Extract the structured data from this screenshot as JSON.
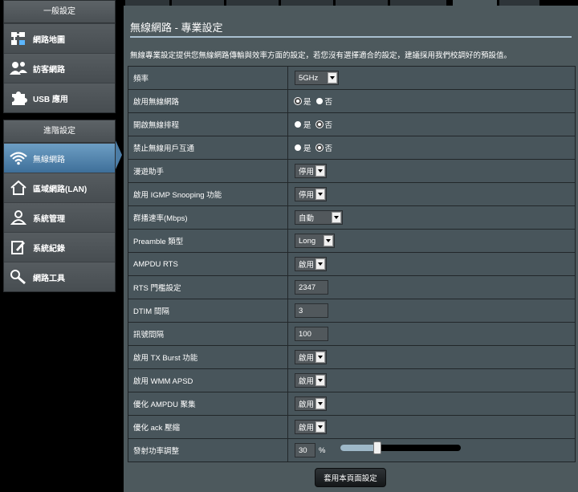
{
  "sidebar": {
    "general_title": "一般設定",
    "general_items": [
      {
        "label": "網路地圖",
        "icon": "network-map-icon"
      },
      {
        "label": "訪客網路",
        "icon": "guest-network-icon"
      },
      {
        "label": "USB 應用",
        "icon": "usb-app-icon"
      }
    ],
    "advanced_title": "進階設定",
    "advanced_items": [
      {
        "label": "無線網路",
        "icon": "wifi-icon",
        "active": true
      },
      {
        "label": "區域網路(LAN)",
        "icon": "home-icon"
      },
      {
        "label": "系統管理",
        "icon": "admin-user-icon"
      },
      {
        "label": "系統紀錄",
        "icon": "log-edit-icon"
      },
      {
        "label": "網路工具",
        "icon": "tools-icon"
      }
    ]
  },
  "page": {
    "title": "無線網路 - 專業設定",
    "description": "無線專業設定提供您無線網路傳輸與效率方面的設定，若您沒有選擇適合的設定，建議採用我們校調好的預設值。",
    "apply_label": "套用本頁面設定"
  },
  "settings": {
    "band": {
      "label": "頻率",
      "value": "5GHz"
    },
    "enable_radio": {
      "label": "啟用無線網路",
      "yes": "是",
      "no": "否"
    },
    "enable_schedule": {
      "label": "開啟無線排程",
      "yes": "是",
      "no": "否"
    },
    "isolation": {
      "label": "禁止無線用戶互通",
      "yes": "是",
      "no": "否"
    },
    "roaming": {
      "label": "漫遊助手",
      "value": "停用"
    },
    "igmp": {
      "label": "啟用 IGMP Snooping 功能",
      "value": "停用"
    },
    "multicast": {
      "label": "群播速率(Mbps)",
      "value": "自動"
    },
    "preamble": {
      "label": "Preamble 類型",
      "value": "Long"
    },
    "ampdu_rts": {
      "label": "AMPDU RTS",
      "value": "啟用"
    },
    "rts": {
      "label": "RTS 門檻設定",
      "value": "2347"
    },
    "dtim": {
      "label": "DTIM 間隔",
      "value": "3"
    },
    "beacon": {
      "label": "訊號間隔",
      "value": "100"
    },
    "tx_burst": {
      "label": "啟用 TX Burst 功能",
      "value": "啟用"
    },
    "wmm_apsd": {
      "label": "啟用 WMM APSD",
      "value": "啟用"
    },
    "ampdu_agg": {
      "label": "優化 AMPDU 聚集",
      "value": "啟用"
    },
    "ack": {
      "label": "優化 ack 壓縮",
      "value": "啟用"
    },
    "tx_power": {
      "label": "發射功率調整",
      "value": "30",
      "unit": "%",
      "level": 0.3
    }
  }
}
